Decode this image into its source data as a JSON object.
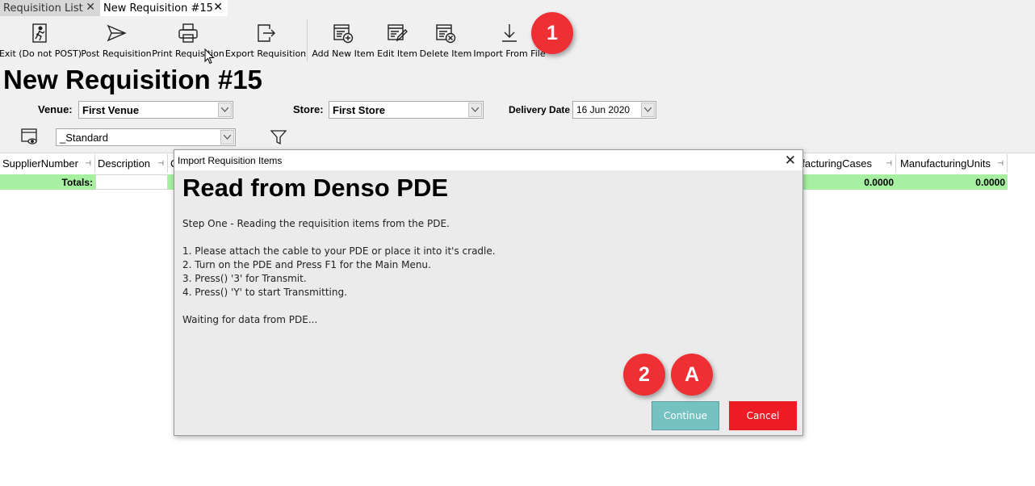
{
  "tabs": [
    {
      "label": "Requisition List"
    },
    {
      "label": "New Requisition #15"
    }
  ],
  "toolbar": {
    "exit": "Exit (Do not POST)",
    "post": "Post Requisition",
    "print": "Print Requisition",
    "export": "Export Requisition",
    "add": "Add New Item",
    "edit": "Edit Item",
    "delete": "Delete Item",
    "import": "Import From File"
  },
  "page_title": "New Requisition #15",
  "filters": {
    "venue_label": "Venue:",
    "venue_value": "First Venue",
    "store_label": "Store:",
    "store_value": "First Store",
    "delivery_label": "Delivery Date",
    "delivery_value": "16 Jun 2020",
    "view_value": "_Standard"
  },
  "grid": {
    "columns": [
      "SupplierNumber",
      "Description",
      "C",
      "ufacturingCases",
      "ManufacturingUnits"
    ],
    "totals_label": "Totals:",
    "totals_cases": "0.0000",
    "totals_units": "0.0000"
  },
  "dialog": {
    "title": "Import Requisition Items",
    "heading": "Read from Denso PDE",
    "step": "Step One - Reading the requisition items from the PDE.",
    "instructions": [
      "1. Please attach the cable to your PDE or place it into it's cradle.",
      "2. Turn on the PDE and Press F1 for the Main Menu.",
      "3. Press() '3' for Transmit.",
      "4. Press() 'Y' to start Transmitting."
    ],
    "waiting": "Waiting for data from PDE...",
    "continue_label": "Continue",
    "cancel_label": "Cancel"
  },
  "badges": [
    "1",
    "2",
    "A"
  ],
  "colors": {
    "badge": "#ee3035",
    "continue": "#76c1c1",
    "cancel": "#ed1c24",
    "totals": "#a7f0a2"
  },
  "icons": [
    "exit-icon",
    "send-icon",
    "printer-icon",
    "export-icon",
    "add-item-icon",
    "edit-item-icon",
    "delete-item-icon",
    "download-icon",
    "view-icon",
    "filter-icon",
    "close-icon",
    "chevron-down-icon"
  ]
}
